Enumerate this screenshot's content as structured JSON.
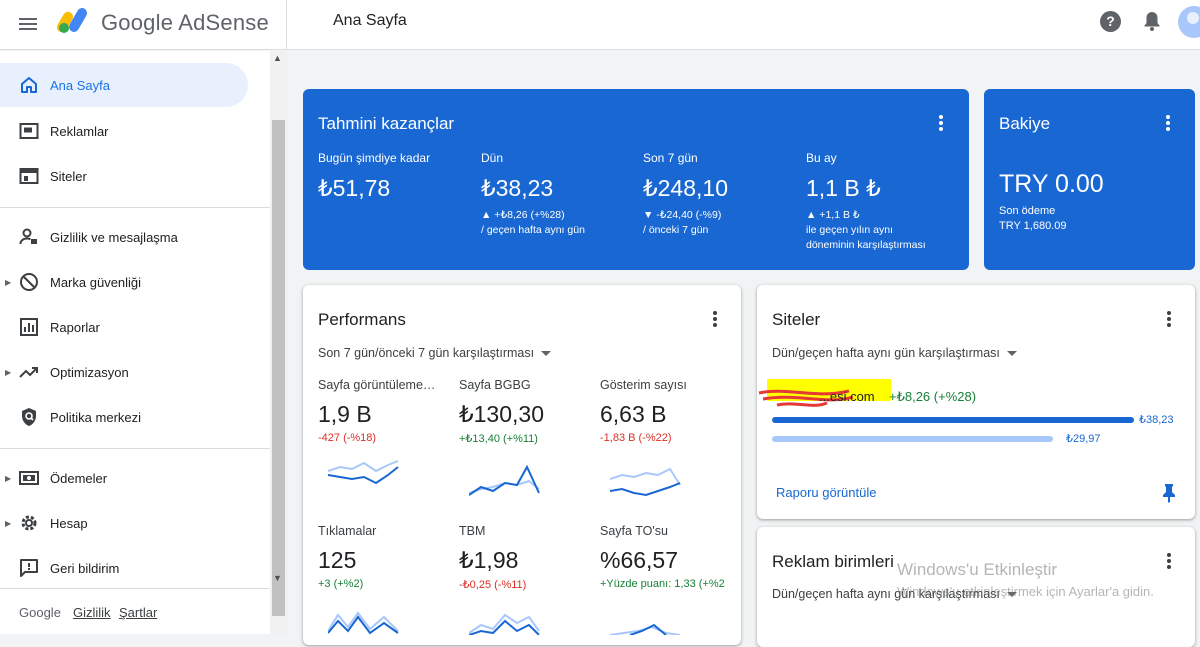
{
  "header": {
    "brand": "Google AdSense",
    "page_title": "Ana Sayfa"
  },
  "sidebar": {
    "items": [
      {
        "label": "Ana Sayfa",
        "icon": "home-icon",
        "active": true
      },
      {
        "label": "Reklamlar",
        "icon": "ads-icon"
      },
      {
        "label": "Siteler",
        "icon": "sites-icon"
      },
      {
        "label": "Gizlilik ve mesajlaşma",
        "icon": "privacy-icon"
      },
      {
        "label": "Marka güvenliği",
        "icon": "block-icon",
        "expandable": true
      },
      {
        "label": "Raporlar",
        "icon": "reports-icon"
      },
      {
        "label": "Optimizasyon",
        "icon": "trending-icon",
        "expandable": true
      },
      {
        "label": "Politika merkezi",
        "icon": "policy-icon"
      },
      {
        "label": "Ödemeler",
        "icon": "payments-icon",
        "expandable": true
      },
      {
        "label": "Hesap",
        "icon": "gear-icon",
        "expandable": true
      },
      {
        "label": "Geri bildirim",
        "icon": "feedback-icon"
      }
    ],
    "footer": {
      "google": "Google",
      "privacy": "Gizlilik",
      "terms": "Şartlar"
    }
  },
  "earnings": {
    "title": "Tahmini kazançlar",
    "stats": [
      {
        "label": "Bugün şimdiye kadar",
        "value": "₺51,78",
        "delta1": "",
        "delta2": ""
      },
      {
        "label": "Dün",
        "value": "₺38,23",
        "delta1": "▲ +₺8,26 (+%28)",
        "delta2": "/ geçen hafta aynı gün"
      },
      {
        "label": "Son 7 gün",
        "value": "₺248,10",
        "delta1": "▼ -₺24,40 (-%9)",
        "delta2": "/ önceki 7 gün"
      },
      {
        "label": "Bu ay",
        "value": "1,1 B ₺",
        "delta1": "▲ +1,1 B ₺",
        "delta2": "ile geçen yılın aynı",
        "delta3": "döneminin karşılaştırması"
      }
    ]
  },
  "balance": {
    "title": "Bakiye",
    "value": "TRY 0.00",
    "last_payment_label": "Son ödeme",
    "last_payment_value": "TRY 1,680.09"
  },
  "performance": {
    "title": "Performans",
    "range": "Son 7 gün/önceki 7 gün karşılaştırması",
    "metrics": [
      {
        "label": "Sayfa görüntüleme…",
        "value": "1,9 B",
        "delta": "-427 (-%18)",
        "trend": "down"
      },
      {
        "label": "Sayfa BGBG",
        "value": "₺130,30",
        "delta": "+₺13,40 (+%11)",
        "trend": "up"
      },
      {
        "label": "Gösterim sayısı",
        "value": "6,63 B",
        "delta": "-1,83 B (-%22)",
        "trend": "down"
      },
      {
        "label": "Tıklamalar",
        "value": "125",
        "delta": "+3 (+%2)",
        "trend": "up"
      },
      {
        "label": "TBM",
        "value": "₺1,98",
        "delta": "-₺0,25 (-%11)",
        "trend": "down"
      },
      {
        "label": "Sayfa TO'su",
        "value": "%66,57",
        "delta": "+Yüzde puanı: 1,33 (+%2",
        "trend": "up"
      }
    ]
  },
  "sites": {
    "title": "Siteler",
    "range": "Dün/geçen hafta aynı gün karşılaştırması",
    "site_name": "...esi.com",
    "site_delta": "+₺8,26 (+%28)",
    "current_value": "₺38,23",
    "previous_value": "₺29,97",
    "current_fraction": 1.0,
    "previous_fraction": 0.78,
    "report_link": "Raporu görüntüle"
  },
  "ad_units": {
    "title": "Reklam birimleri",
    "range": "Dün/geçen hafta aynı gün karşılaştırması"
  },
  "watermark": {
    "line1": "Windows'u Etkinleştir",
    "line2": "Windows'u etkinleştirmek için Ayarlar'a gidin."
  },
  "colors": {
    "primary": "#1967d2",
    "active_bg": "#e8f0fe",
    "negative": "#d93025",
    "positive": "#188038",
    "bar_previous": "#a8c7fa"
  }
}
